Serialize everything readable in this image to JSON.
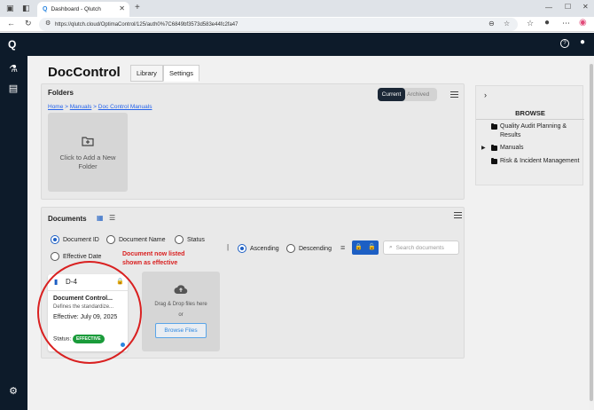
{
  "browser": {
    "tab_title": "Dashboard - Qlutch",
    "url": "https://qlutch.cloud/OptimaControl/125/auth0%7C6849bf3573d583e44fc2fa47",
    "new_tab": "+"
  },
  "app": {
    "page_title": "DocControl",
    "tabs": [
      "Library",
      "Settings"
    ]
  },
  "folders": {
    "title": "Folders",
    "toggle_current": "Current",
    "toggle_archived": "Archived",
    "breadcrumb": [
      "Home",
      "Manuals",
      "Doc Control Manuals"
    ],
    "breadcrumb_sep": ">",
    "add_folder_label": "Click to Add a New Folder"
  },
  "documents": {
    "title": "Documents",
    "sort_options": [
      "Document ID",
      "Document Name",
      "Status",
      "Effective Date"
    ],
    "selected_sort": "Document ID",
    "order_options": [
      "Ascending",
      "Descending"
    ],
    "selected_order": "Ascending",
    "separator": "|",
    "search_placeholder": "Search documents",
    "card": {
      "doc_id": "D-4",
      "doc_title": "Document Control...",
      "description": "Defines the standardize...",
      "effective_label": "Effective:",
      "effective_date": "July 09, 2025",
      "status_label": "Status:",
      "status_value": "EFFECTIVE"
    },
    "upload": {
      "drag_text": "Drag & Drop files here",
      "or_text": "or",
      "browse_button": "Browse Files"
    }
  },
  "annotation": {
    "line1": "Document now listed",
    "line2": "shown as effective"
  },
  "browse": {
    "title": "BROWSE",
    "items": [
      "Quality Audit Planning & Results",
      "Manuals",
      "Risk & Incident Management"
    ]
  },
  "colors": {
    "nav_bg": "#0d1b2a",
    "accent": "#1d5fc4",
    "status_green": "#1a9b3a",
    "annotation_red": "#d92020"
  }
}
